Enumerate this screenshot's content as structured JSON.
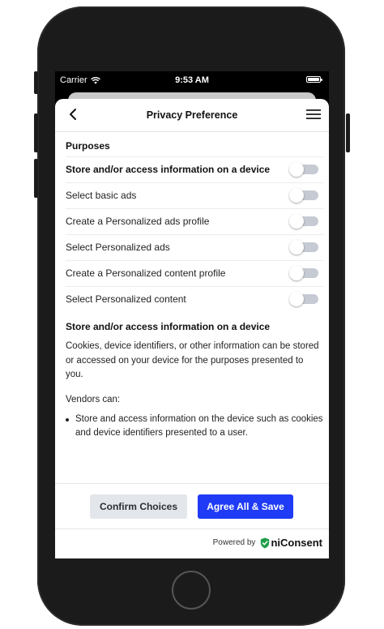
{
  "status_bar": {
    "carrier": "Carrier",
    "time": "9:53 AM",
    "wifi_icon": "wifi-icon",
    "battery_icon": "battery-icon"
  },
  "header": {
    "title": "Privacy Preference",
    "back_icon": "chevron-left-icon",
    "menu_icon": "hamburger-menu-icon"
  },
  "purposes": {
    "heading": "Purposes",
    "items": [
      {
        "label": "Store and/or access information on a device",
        "bold": true,
        "enabled": false
      },
      {
        "label": "Select basic ads",
        "bold": false,
        "enabled": false
      },
      {
        "label": "Create a Personalized ads profile",
        "bold": false,
        "enabled": false
      },
      {
        "label": "Select Personalized ads",
        "bold": false,
        "enabled": false
      },
      {
        "label": "Create a Personalized content profile",
        "bold": false,
        "enabled": false
      },
      {
        "label": "Select Personalized content",
        "bold": false,
        "enabled": false
      }
    ]
  },
  "detail": {
    "title": "Store and/or access information on a device",
    "description": "Cookies, device identifiers, or other information can be stored or accessed on your device for the purposes presented to you.",
    "vendors_label": "Vendors can:",
    "vendors_bullets": [
      "Store and access information on the device such as cookies and device identifiers presented to a user."
    ]
  },
  "actions": {
    "confirm_label": "Confirm Choices",
    "agree_label": "Agree All & Save"
  },
  "footer": {
    "powered_by": "Powered by",
    "brand_name": "niConsent",
    "brand_icon": "shield-check-icon"
  },
  "colors": {
    "accent": "#1f3bf5",
    "secondary_button": "#e3e6ea",
    "toggle_off": "#c5cad3",
    "brand_green": "#1e9e4a"
  }
}
